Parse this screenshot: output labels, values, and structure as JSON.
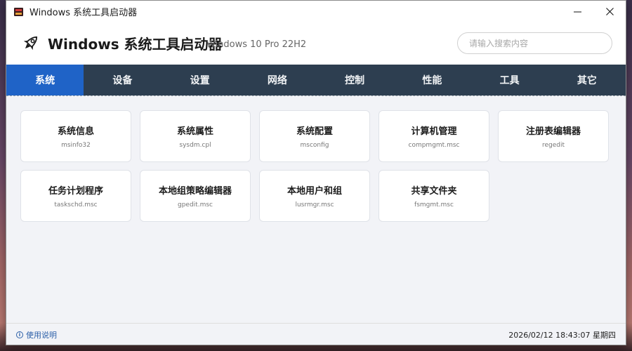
{
  "window": {
    "title": "Windows 系统工具启动器"
  },
  "header": {
    "title": "Windows 系统工具启动器",
    "os_version": "Windows 10 Pro 22H2",
    "search_placeholder": "请输入搜索内容"
  },
  "tabs": [
    {
      "label": "系统",
      "active": true
    },
    {
      "label": "设备",
      "active": false
    },
    {
      "label": "设置",
      "active": false
    },
    {
      "label": "网络",
      "active": false
    },
    {
      "label": "控制",
      "active": false
    },
    {
      "label": "性能",
      "active": false
    },
    {
      "label": "工具",
      "active": false
    },
    {
      "label": "其它",
      "active": false
    }
  ],
  "tools": [
    {
      "name": "系统信息",
      "command": "msinfo32"
    },
    {
      "name": "系统属性",
      "command": "sysdm.cpl"
    },
    {
      "name": "系统配置",
      "command": "msconfig"
    },
    {
      "name": "计算机管理",
      "command": "compmgmt.msc"
    },
    {
      "name": "注册表编辑器",
      "command": "regedit"
    },
    {
      "name": "任务计划程序",
      "command": "taskschd.msc"
    },
    {
      "name": "本地组策略编辑器",
      "command": "gpedit.msc"
    },
    {
      "name": "本地用户和组",
      "command": "lusrmgr.msc"
    },
    {
      "name": "共享文件夹",
      "command": "fsmgmt.msc"
    }
  ],
  "status": {
    "help_label": "使用说明",
    "datetime": "2026/02/12 18:43:07 星期四"
  },
  "colors": {
    "tab_bar": "#2d3e50",
    "tab_active": "#1f63c7",
    "content_bg": "#f2f3f7",
    "link": "#2b5fa8"
  },
  "icons": {
    "logo": "rocket-icon",
    "window": "app-icon",
    "minimize": "minimize-icon",
    "close": "close-icon",
    "help": "info-icon"
  }
}
